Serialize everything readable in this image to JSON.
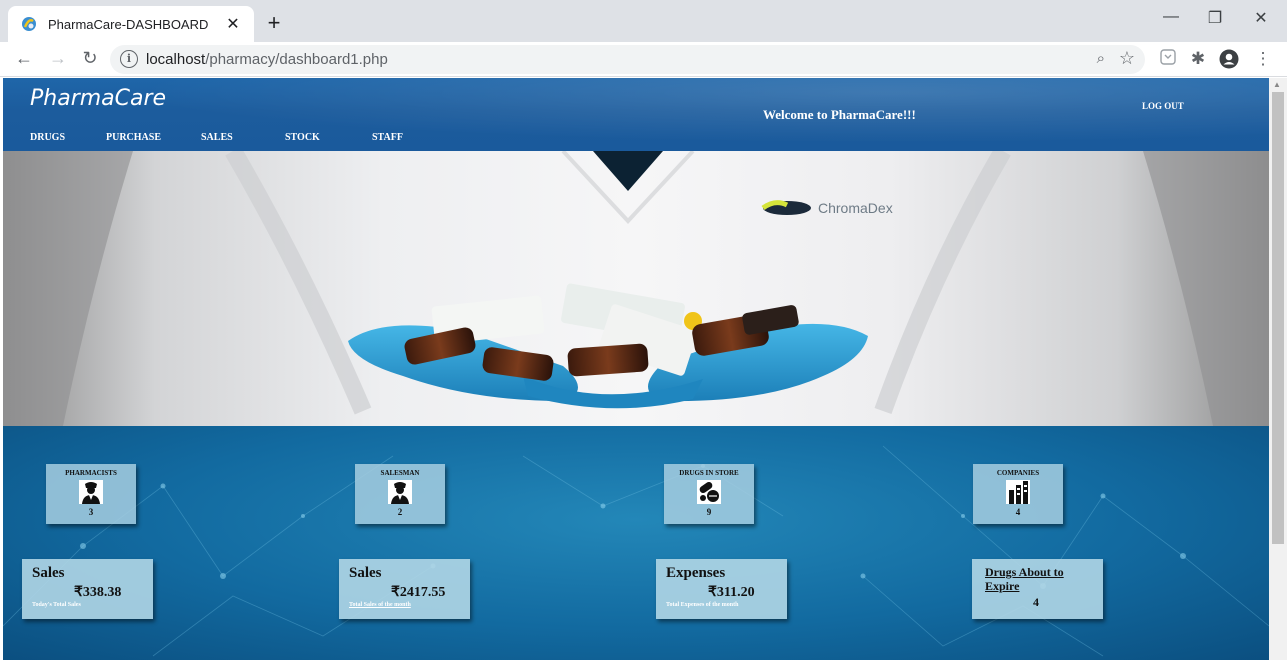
{
  "browser": {
    "tab_title": "PharmaCare-DASHBOARD",
    "tab_close": "✕",
    "new_tab": "+",
    "url_host": "localhost",
    "url_path": "/pharmacy/dashboard1.php",
    "info_glyph": "i",
    "window_controls": [
      "—",
      "❐",
      "✕"
    ]
  },
  "header": {
    "brand": "PharmaCare",
    "welcome": "Welcome to PharmaCare!!!",
    "logout": "LOG OUT",
    "menu": [
      "DRUGS",
      "PURCHASE",
      "SALES",
      "STOCK",
      "STAFF"
    ]
  },
  "hero": {
    "coat_brand": "ChromaDex"
  },
  "stats": [
    {
      "label": "PHARMACISTS",
      "icon": "pharmacist-icon",
      "value": "3"
    },
    {
      "label": "SALESMAN",
      "icon": "salesman-icon",
      "value": "2"
    },
    {
      "label": "DRUGS IN STORE",
      "icon": "pills-icon",
      "value": "9"
    },
    {
      "label": "COMPANIES",
      "icon": "companies-icon",
      "value": "4"
    }
  ],
  "cards": [
    {
      "title": "Sales",
      "value": "₹338.38",
      "sub": "Today's Total Sales"
    },
    {
      "title": "Sales",
      "value": "₹2417.55",
      "sub": "Total Sales of the month"
    },
    {
      "title": "Expenses",
      "value": "₹311.20",
      "sub": "Total Expenses of the month"
    },
    {
      "title": "Drugs About to Expire",
      "value": "4"
    }
  ]
}
